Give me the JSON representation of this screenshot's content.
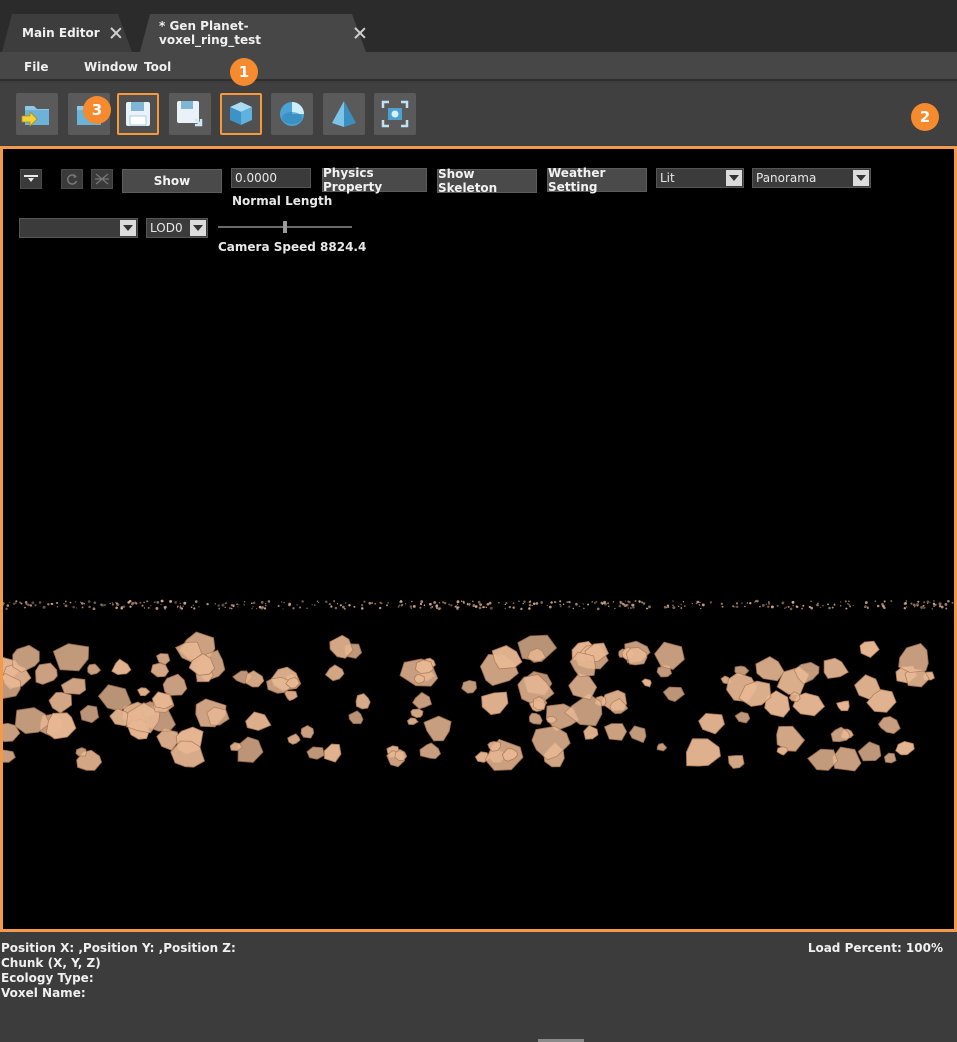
{
  "tabs": [
    {
      "label": "Main Editor",
      "active": false
    },
    {
      "label": "* Gen Planet-voxel_ring_test",
      "active": true
    }
  ],
  "menu": [
    "File",
    "Window",
    "Tool"
  ],
  "toolbar": {
    "buttons": [
      {
        "icon": "import-folder-icon",
        "highlighted": false
      },
      {
        "icon": "open-folder-icon",
        "highlighted": false
      },
      {
        "icon": "save-icon",
        "highlighted": true
      },
      {
        "icon": "save-as-icon",
        "highlighted": false
      },
      {
        "icon": "cube-icon",
        "highlighted": true
      },
      {
        "icon": "sphere-icon",
        "highlighted": false
      },
      {
        "icon": "pyramid-icon",
        "highlighted": false
      },
      {
        "icon": "capture-icon",
        "highlighted": false
      }
    ],
    "badges": [
      "1",
      "2",
      "3"
    ],
    "highlight_color": "#f7993a"
  },
  "viewport": {
    "show_button": "Show",
    "normal_length_value": "0.0000",
    "normal_length_label": "Normal Length",
    "physics_button": "Physics Property",
    "skeleton_button": "Show Skeleton",
    "weather_button": "Weather Setting",
    "shading_select": "Lit",
    "view_select": "Panorama",
    "layer_select": "",
    "lod_select": "LOD0",
    "camera_speed_label": "Camera Speed 8824.4",
    "camera_speed_fraction": 0.5,
    "border_color": "#f29a4a",
    "rock_color": "#e8b894"
  },
  "status": {
    "position": "Position X: ,Position Y: ,Position Z:",
    "chunk": "Chunk (X, Y, Z)",
    "ecology": "Ecology Type:",
    "voxel": "Voxel Name:",
    "load": "Load Percent: 100%"
  }
}
